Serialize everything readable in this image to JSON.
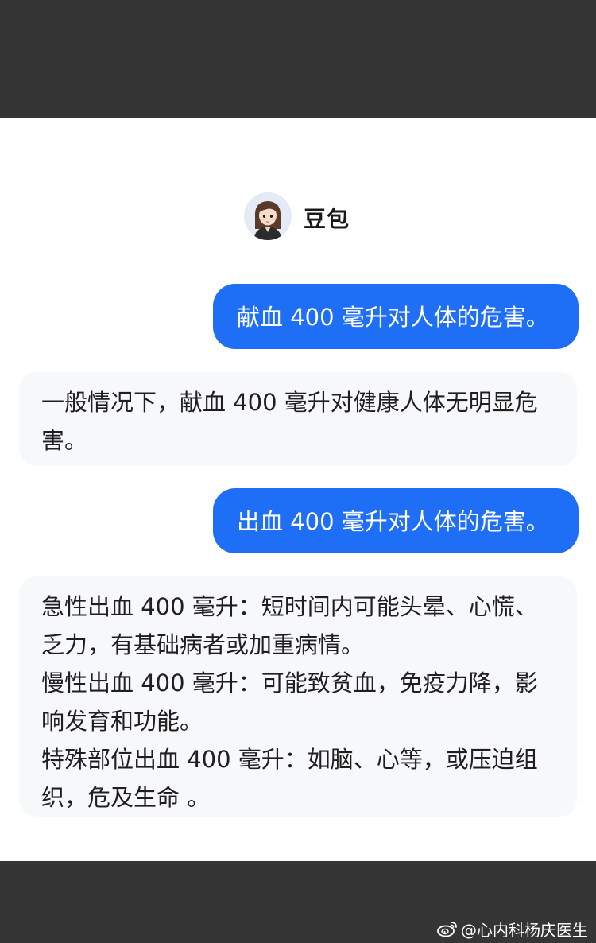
{
  "header": {
    "bot_name": "豆包",
    "avatar_icon": "cartoon-girl-avatar"
  },
  "messages": [
    {
      "role": "user",
      "text": "献血 400 毫升对人体的危害。"
    },
    {
      "role": "assistant",
      "lines": [
        "一般情况下，献血 400 毫升对健康人体无明显危害。"
      ]
    },
    {
      "role": "user",
      "text": "出血 400 毫升对人体的危害。"
    },
    {
      "role": "assistant",
      "lines": [
        "急性出血 400 毫升：短时间内可能头晕、心慌、乏力，有基础病者或加重病情。",
        "慢性出血 400 毫升：可能致贫血，免疫力降，影响发育和功能。",
        "特殊部位出血 400 毫升：如脑、心等，或压迫组织，危及生命 。"
      ]
    }
  ],
  "watermark": {
    "text": "@心内科杨庆医生",
    "icon": "weibo-logo"
  },
  "colors": {
    "user_bubble": "#1f6ef6",
    "bot_bubble": "#f7f8fa",
    "frame": "#353535"
  }
}
